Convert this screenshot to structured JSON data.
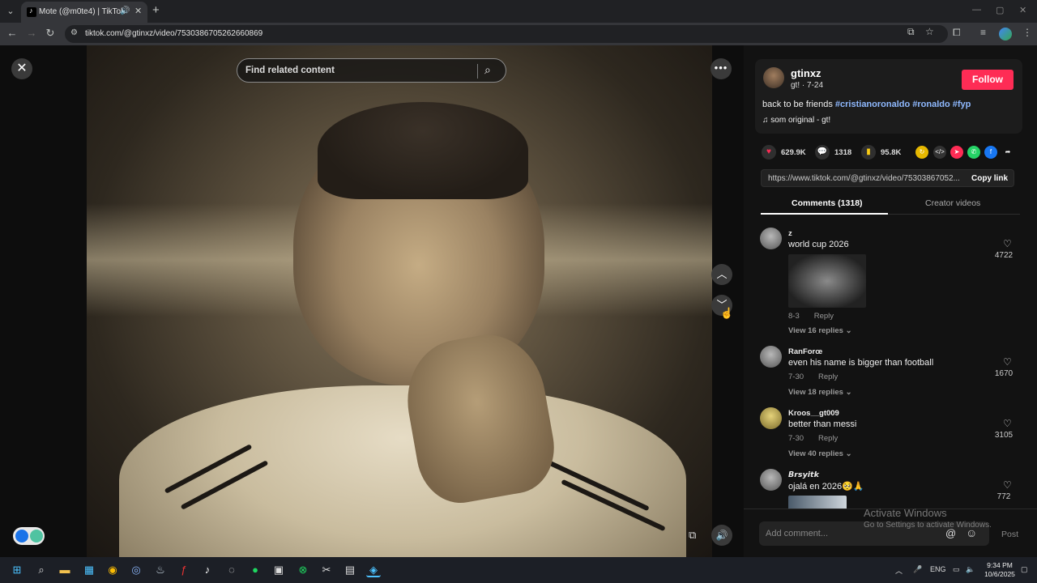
{
  "browser": {
    "tab_title": "Mote (@m0te4) | TikTok",
    "url": "tiktok.com/@gtinxz/video/7530386705262660869"
  },
  "player": {
    "search_placeholder": "Find related content"
  },
  "video_info": {
    "author": "gtinxz",
    "author_sub": "gt! · 7-24",
    "follow_label": "Follow",
    "description_text": "back to be friends",
    "hashtags": [
      "#cristianoronaldo",
      "#ronaldo",
      "#fyp"
    ],
    "music": "som original - gt!"
  },
  "stats": {
    "likes": "629.9K",
    "comments": "1318",
    "saves": "95.8K"
  },
  "share_link": {
    "url": "https://www.tiktok.com/@gtinxz/video/75303867052...",
    "copy_label": "Copy link"
  },
  "tabs": {
    "comments": "Comments (1318)",
    "creator_videos": "Creator videos"
  },
  "comments": [
    {
      "name": "z",
      "text": "world cup 2026",
      "date": "8-3",
      "reply": "Reply",
      "views": "View 16 replies",
      "likes": "4722"
    },
    {
      "name": "RanForœ",
      "text": "even his name is bigger than football",
      "date": "7-30",
      "reply": "Reply",
      "views": "View 18 replies",
      "likes": "1670"
    },
    {
      "name": "Kroos__gt009",
      "text": "better than messi",
      "date": "7-30",
      "reply": "Reply",
      "views": "View 40 replies",
      "likes": "3105"
    },
    {
      "name": "𝘽𝙧𝙨𝙮𝙞𝙩𝙠",
      "text": "ojalá en 2026🥺🙏",
      "likes": "772"
    }
  ],
  "comment_box": {
    "placeholder": "Add comment...",
    "post_label": "Post"
  },
  "watermark": {
    "line1": "Activate Windows",
    "line2": "Go to Settings to activate Windows."
  },
  "taskbar": {
    "lang": "ENG",
    "time": "9:34 PM",
    "date": "10/6/2025"
  }
}
